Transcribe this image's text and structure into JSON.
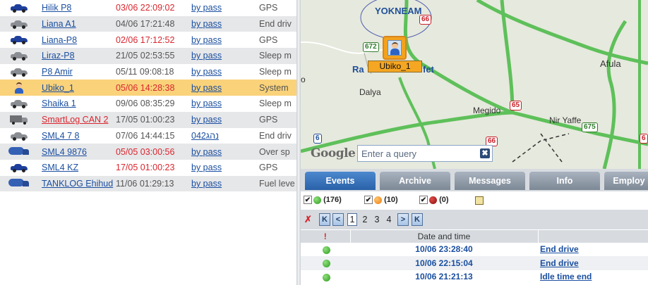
{
  "vehicles": [
    {
      "icon": "car-blue",
      "name": "Hilik P8",
      "time": "03/06 22:09:02",
      "time_color": "red",
      "action": "by pass",
      "status": "GPS"
    },
    {
      "icon": "car-gray",
      "name": "Liana A1",
      "time": "04/06 17:21:48",
      "time_color": "gray",
      "action": "by pass",
      "status": "End driv"
    },
    {
      "icon": "car-blue",
      "name": "Liana-P8",
      "time": "02/06 17:12:52",
      "time_color": "red",
      "action": "by pass",
      "status": "GPS"
    },
    {
      "icon": "car-gray",
      "name": "Liraz-P8",
      "time": "21/05 02:53:55",
      "time_color": "gray",
      "action": "by pass",
      "status": "Sleep m"
    },
    {
      "icon": "car-gray",
      "name": "P8 Amir",
      "time": "05/11 09:08:18",
      "time_color": "gray",
      "action": "by pass",
      "status": "Sleep m"
    },
    {
      "icon": "person",
      "name": "Ubiko_1",
      "time": "05/06 14:28:38",
      "time_color": "red",
      "action": "by pass",
      "status": "System",
      "selected": true
    },
    {
      "icon": "car-gray",
      "name": "Shaika 1",
      "time": "09/06 08:35:29",
      "time_color": "gray",
      "action": "by pass",
      "status": "Sleep m"
    },
    {
      "icon": "truck",
      "name": "SmartLog CAN 2",
      "name_color": "red",
      "time": "17/05 01:00:23",
      "time_color": "gray",
      "action": "by pass",
      "status": "GPS"
    },
    {
      "icon": "car-gray",
      "name": "SML4 7 8",
      "time": "07/06 14:44:15",
      "time_color": "gray",
      "action": "נהג042",
      "status": "End driv"
    },
    {
      "icon": "tanker",
      "name": "SML4 9876",
      "time": "05/05 03:00:56",
      "time_color": "red",
      "action": "by pass",
      "status": "Over sp"
    },
    {
      "icon": "car-blue",
      "name": "SML4 KZ",
      "time": "17/05 01:00:23",
      "time_color": "red",
      "action": "by pass",
      "status": "GPS"
    },
    {
      "icon": "tanker",
      "name": "TANKLOG Ehihud",
      "time": "11/06 01:29:13",
      "time_color": "gray",
      "action": "by pass",
      "status": "Fuel leve"
    }
  ],
  "map": {
    "places": {
      "yokneam": "YOKNEAM",
      "ra": "Ra",
      "fet": "fet",
      "dalya": "Dalya",
      "afula": "Afula",
      "megido": "Megido",
      "nir_yaffe": "Nir Yaffe",
      "edge_o": "o"
    },
    "roads": {
      "r66_top": "66",
      "r672": "672",
      "r65": "65",
      "r66_mid": "66",
      "r675": "675",
      "r6": "6",
      "r6_right": "6"
    },
    "marker_label": "Ubiko_1",
    "google_logo": "Google",
    "query_placeholder": "Enter a query",
    "clear_symbol": "✖"
  },
  "tabs": [
    {
      "label": "Events",
      "active": true
    },
    {
      "label": "Archive",
      "active": false
    },
    {
      "label": "Messages",
      "active": false
    },
    {
      "label": "Info",
      "active": false
    },
    {
      "label": "Employ",
      "active": false
    }
  ],
  "filters": [
    {
      "color": "green",
      "count": "(176)",
      "checked": true
    },
    {
      "color": "orange",
      "count": "(10)",
      "checked": true
    },
    {
      "color": "darkred",
      "count": "(0)",
      "checked": true
    }
  ],
  "pager": {
    "first": "K",
    "prev": "<",
    "pages": [
      "1",
      "2",
      "3",
      "4"
    ],
    "current_page": "1",
    "next": ">",
    "last": "K"
  },
  "events_table": {
    "headers": {
      "type": "!",
      "datetime": "Date and time",
      "event": ""
    },
    "rows": [
      {
        "type": "green",
        "datetime": "10/06 23:28:40",
        "event": "End drive"
      },
      {
        "type": "green",
        "datetime": "10/06 22:15:04",
        "event": "End drive"
      },
      {
        "type": "green",
        "datetime": "10/06 21:21:13",
        "event": "Idle time end"
      }
    ]
  },
  "colors": {
    "link_blue": "#1b4fa0",
    "alert_red": "#d9262e",
    "selected_row": "#f9d27a",
    "tab_active": "#2a62a8"
  }
}
